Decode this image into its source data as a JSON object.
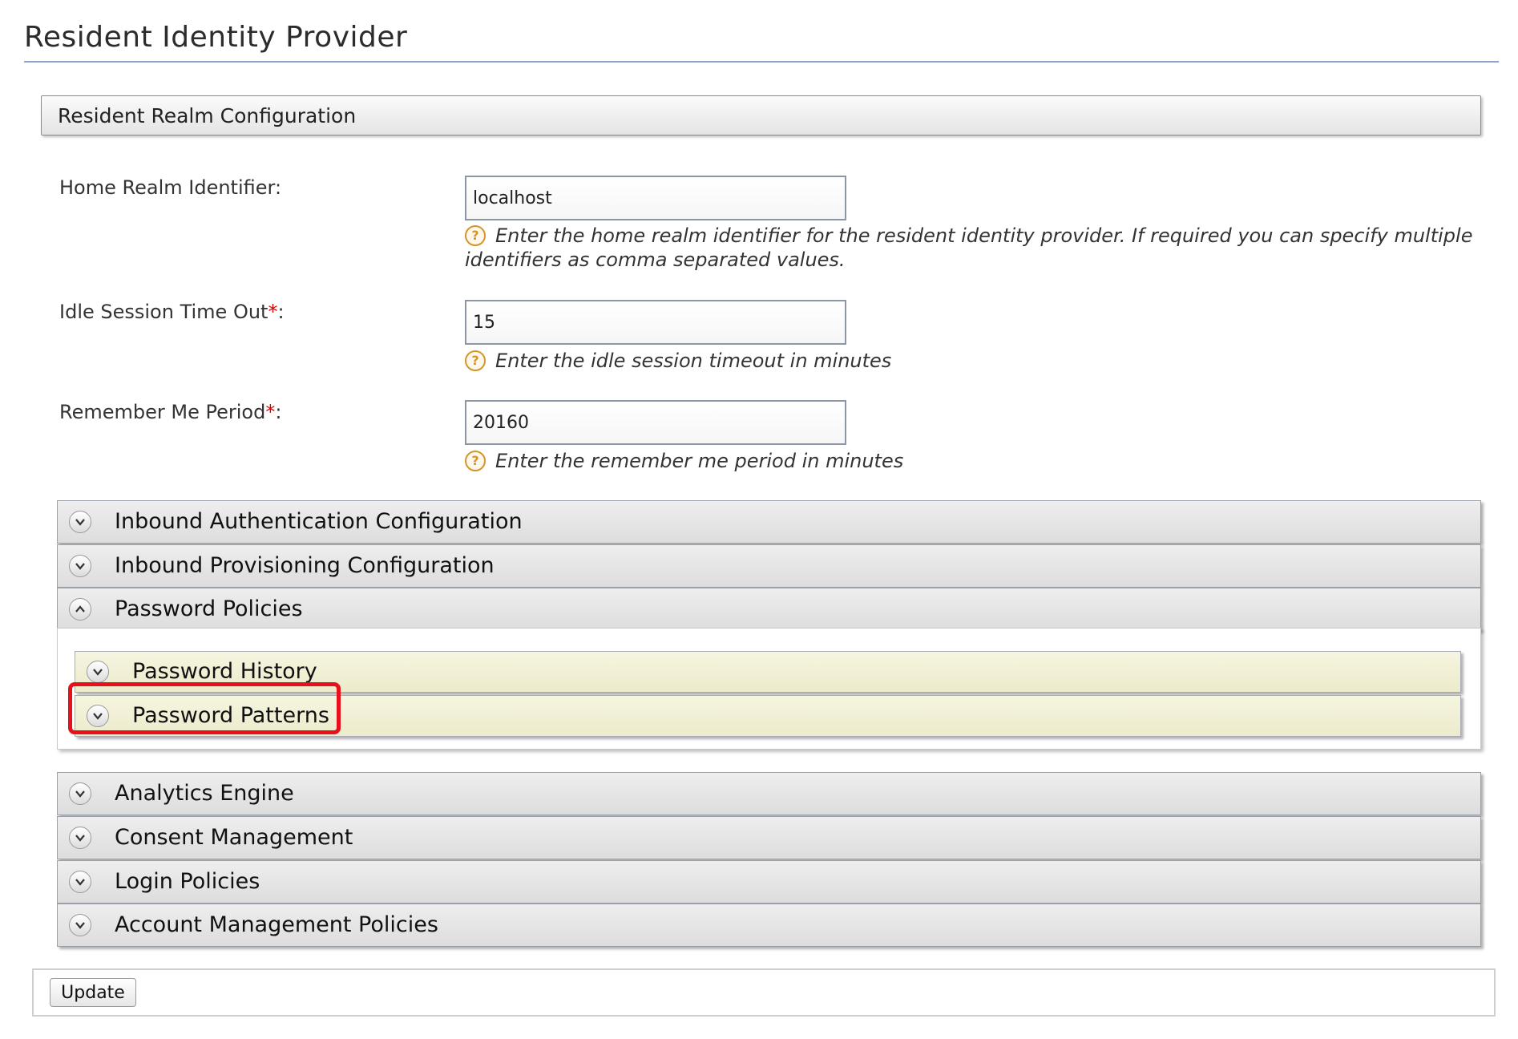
{
  "page": {
    "title": "Resident Identity Provider"
  },
  "realm_section": {
    "header": "Resident Realm Configuration"
  },
  "fields": {
    "home_realm": {
      "label": "Home Realm Identifier:",
      "value": "localhost",
      "help_line1": "Enter the home realm identifier for the resident identity provider. If required you can specify multiple",
      "help_line2": "identifiers as comma separated values."
    },
    "idle_timeout": {
      "label": "Idle Session Time Out",
      "required_mark": "*",
      "suffix": ":",
      "value": "15",
      "help": "Enter the idle session timeout in minutes"
    },
    "remember_me": {
      "label": "Remember Me Period",
      "required_mark": "*",
      "suffix": ":",
      "value": "20160",
      "help": "Enter the remember me period in minutes"
    }
  },
  "help_icon_glyph": "?",
  "sections": [
    {
      "label": "Inbound Authentication Configuration",
      "expanded": false
    },
    {
      "label": "Inbound Provisioning Configuration",
      "expanded": false
    },
    {
      "label": "Password Policies",
      "expanded": true
    },
    {
      "label": "Analytics Engine",
      "expanded": false
    },
    {
      "label": "Consent Management",
      "expanded": false
    },
    {
      "label": "Login Policies",
      "expanded": false
    },
    {
      "label": "Account Management Policies",
      "expanded": false
    }
  ],
  "password_policies": {
    "subsections": [
      {
        "label": "Password History",
        "expanded": false,
        "highlighted": false
      },
      {
        "label": "Password Patterns",
        "expanded": false,
        "highlighted": true
      }
    ]
  },
  "highlight_color": "#e8101c",
  "footer": {
    "update_label": "Update"
  }
}
